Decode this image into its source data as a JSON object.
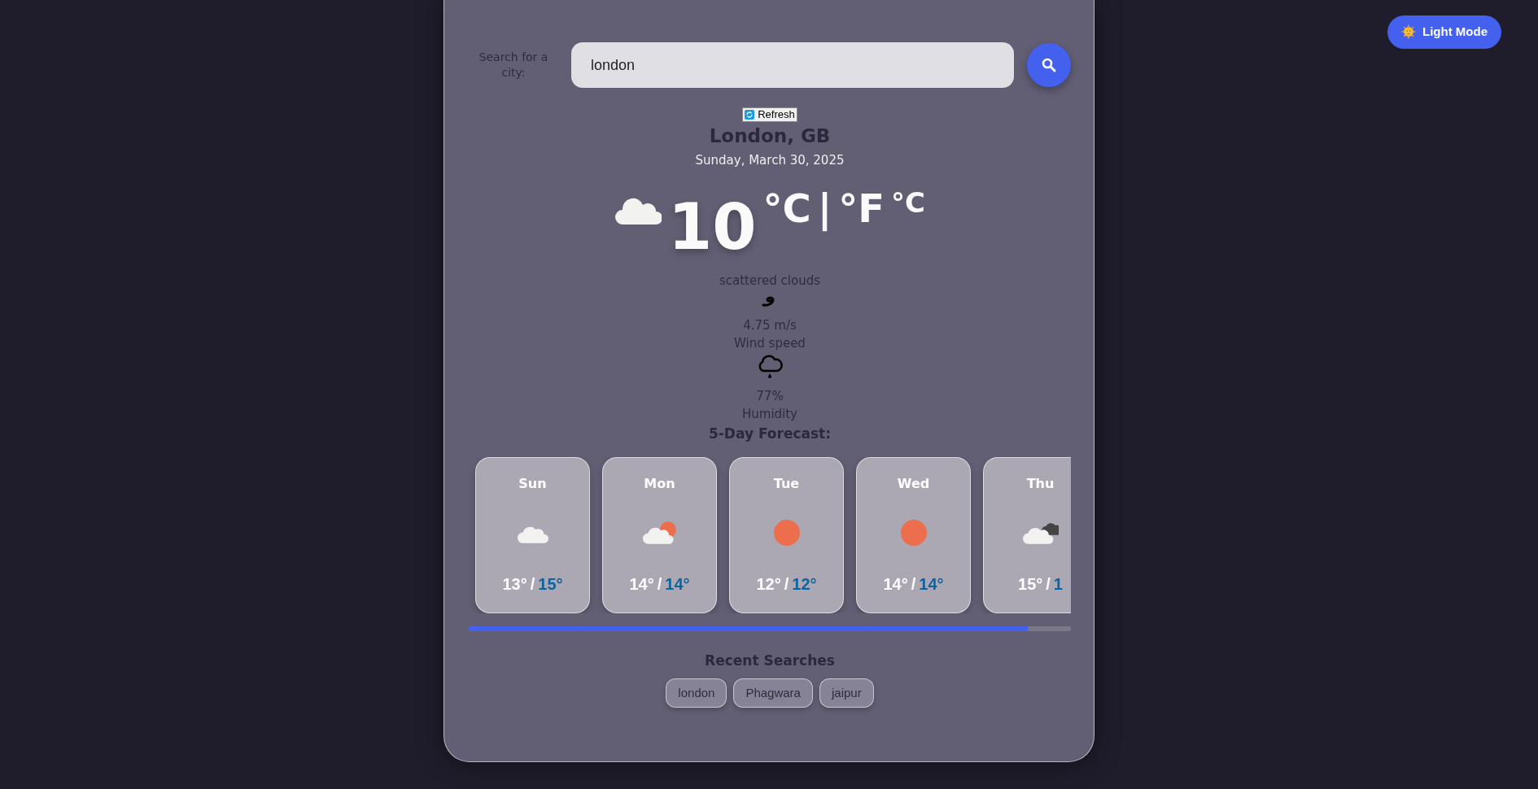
{
  "theme_toggle": {
    "label": "Light Mode"
  },
  "search": {
    "label": "Search for a city:",
    "value": "london"
  },
  "refresh": {
    "label": "Refresh"
  },
  "current": {
    "city": "London, GB",
    "date": "Sunday, March 30, 2025",
    "temperature": "10",
    "unit_celsius": "°C",
    "separator": "|",
    "unit_fahrenheit": "°F",
    "unit_extra": "°C",
    "description": "scattered clouds",
    "wind_value": "4.75 m/s",
    "wind_label": "Wind speed",
    "humidity_value": "77%",
    "humidity_label": "Humidity"
  },
  "forecast": {
    "title": "5-Day Forecast:",
    "days": [
      {
        "day": "Sun",
        "kind": "cloud",
        "low": "13°",
        "slash": "/",
        "high": "15°"
      },
      {
        "day": "Mon",
        "kind": "partly-sunny",
        "low": "14°",
        "slash": "/",
        "high": "14°"
      },
      {
        "day": "Tue",
        "kind": "sun",
        "low": "12°",
        "slash": "/",
        "high": "12°"
      },
      {
        "day": "Wed",
        "kind": "sun",
        "low": "14°",
        "slash": "/",
        "high": "14°"
      },
      {
        "day": "Thu",
        "kind": "cloudy-dark",
        "low": "15°",
        "slash": "/",
        "high": "1"
      }
    ]
  },
  "recent": {
    "title": "Recent Searches",
    "items": [
      "london",
      "Phagwara",
      "jaipur"
    ]
  }
}
